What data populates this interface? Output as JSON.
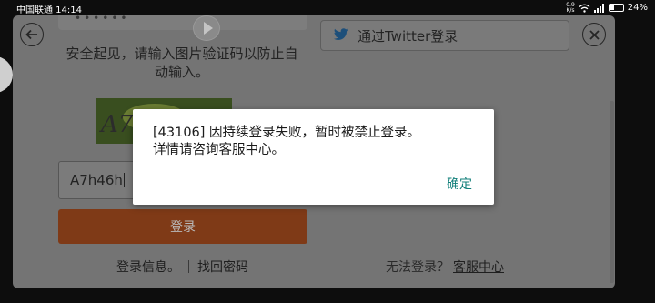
{
  "status_bar": {
    "carrier_time": "中国联通 14:14",
    "net_speed_value": "0.9",
    "net_speed_unit": "K/s",
    "battery": "24%"
  },
  "page": {
    "security_text": "安全起见，请输入图片验证码以防止自动输入。",
    "twitter_label": "通过Twitter登录",
    "twitter_icon": "twitter-bird-icon",
    "captcha_text": "A7",
    "code_value": "A7h46h",
    "login_label": "登录",
    "login_info": "登录信息。",
    "find_password": "找回密码",
    "cannot_login": "无法登录？",
    "customer_service": "客服中心"
  },
  "dialog": {
    "message": "[43106] 因持续登录失败，暂时被禁止登录。\n详情请咨询客服中心。",
    "ok_label": "确定"
  },
  "colors": {
    "accent": "#117f7a",
    "login_button": "#7f3a17",
    "overlay_page": "#747474"
  }
}
